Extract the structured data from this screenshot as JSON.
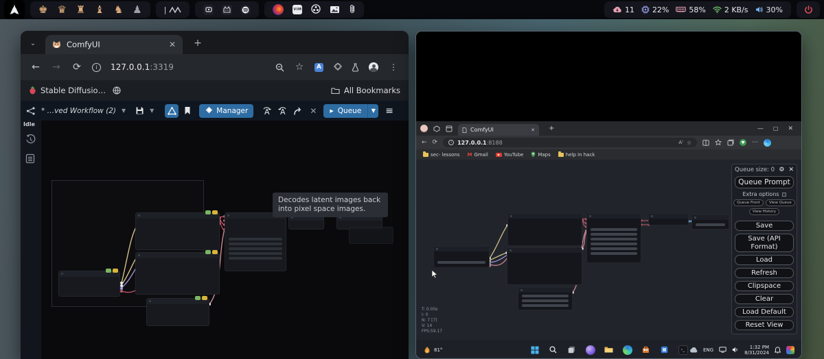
{
  "topbar": {
    "notif_count": "11",
    "cpu": "22%",
    "ram": "58%",
    "net": "2 KB/s",
    "vol": "30%"
  },
  "left_window": {
    "tab_title": "ComfyUI",
    "url_host": "127.0.0.1",
    "url_port": ":3319",
    "bookmark_sd": "Stable Diffusio…",
    "all_bookmarks": "All Bookmarks",
    "menubar": {
      "workflow_label": "* …ved Workflow (2)",
      "manager_label": "Manager",
      "queue_label": "Queue"
    },
    "status_idle": "Idle",
    "tooltip": "Decodes latent images back into pixel space images."
  },
  "right_window": {
    "tab_title": "ComfyUI",
    "url_host": "127.0.0.1",
    "url_port": ":8188",
    "bookmarks": [
      "sec- lessons",
      "Gmail",
      "YouTube",
      "Maps",
      "help in hack"
    ],
    "panel": {
      "queue_size": "Queue size: 0",
      "queue_prompt": "Queue Prompt",
      "extra_options": "Extra options",
      "queue_front": "Queue Front",
      "view_queue": "View Queue",
      "view_history": "View History",
      "actions": [
        "Save",
        "Save (API Format)",
        "Load",
        "Refresh",
        "Clipspace",
        "Clear",
        "Load Default",
        "Reset View"
      ]
    },
    "canvas_stats": [
      "T: 0.00s",
      "I: 0",
      "N: 7 [7]",
      "V: 14",
      "FPS:59.17"
    ],
    "taskbar": {
      "temp": "81°",
      "lang": "ENG",
      "time": "1:32 PM",
      "date": "8/31/2024"
    }
  }
}
